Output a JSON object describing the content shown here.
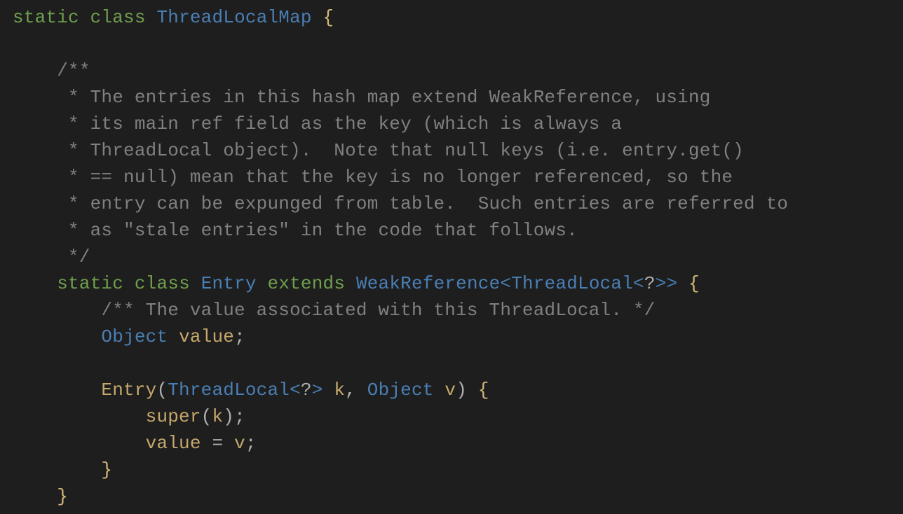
{
  "code": {
    "line1": {
      "kw_static": "static",
      "kw_class": "class",
      "name": "ThreadLocalMap",
      "brace": "{"
    },
    "comment1": {
      "l0": "/**",
      "l1": " * The entries in this hash map extend WeakReference, using",
      "l2": " * its main ref field as the key (which is always a",
      "l3": " * ThreadLocal object).  Note that null keys (i.e. entry.get()",
      "l4": " * == null) mean that the key is no longer referenced, so the",
      "l5": " * entry can be expunged from table.  Such entries are referred to",
      "l6": " * as \"stale entries\" in the code that follows.",
      "l7": " */"
    },
    "line2": {
      "kw_static": "static",
      "kw_class": "class",
      "name": "Entry",
      "kw_extends": "extends",
      "type1": "WeakReference",
      "lt1": "<",
      "type2": "ThreadLocal",
      "lt2": "<",
      "wild": "?",
      "gt2": ">",
      "gt1": ">",
      "brace": "{"
    },
    "comment2": "/** The value associated with this ThreadLocal. */",
    "line3": {
      "type": "Object",
      "ident": "value",
      "semi": ";"
    },
    "line4": {
      "ctor": "Entry",
      "lp": "(",
      "type1": "ThreadLocal",
      "lt": "<",
      "wild": "?",
      "gt": ">",
      "p1": "k",
      "comma": ",",
      "type2": "Object",
      "p2": "v",
      "rp": ")",
      "brace": "{"
    },
    "line5": {
      "call": "super",
      "lp": "(",
      "arg": "k",
      "rp": ")",
      "semi": ";"
    },
    "line6": {
      "lhs": "value",
      "eq": "=",
      "rhs": "v",
      "semi": ";"
    },
    "line7": {
      "brace": "}"
    },
    "line8": {
      "brace": "}"
    }
  }
}
